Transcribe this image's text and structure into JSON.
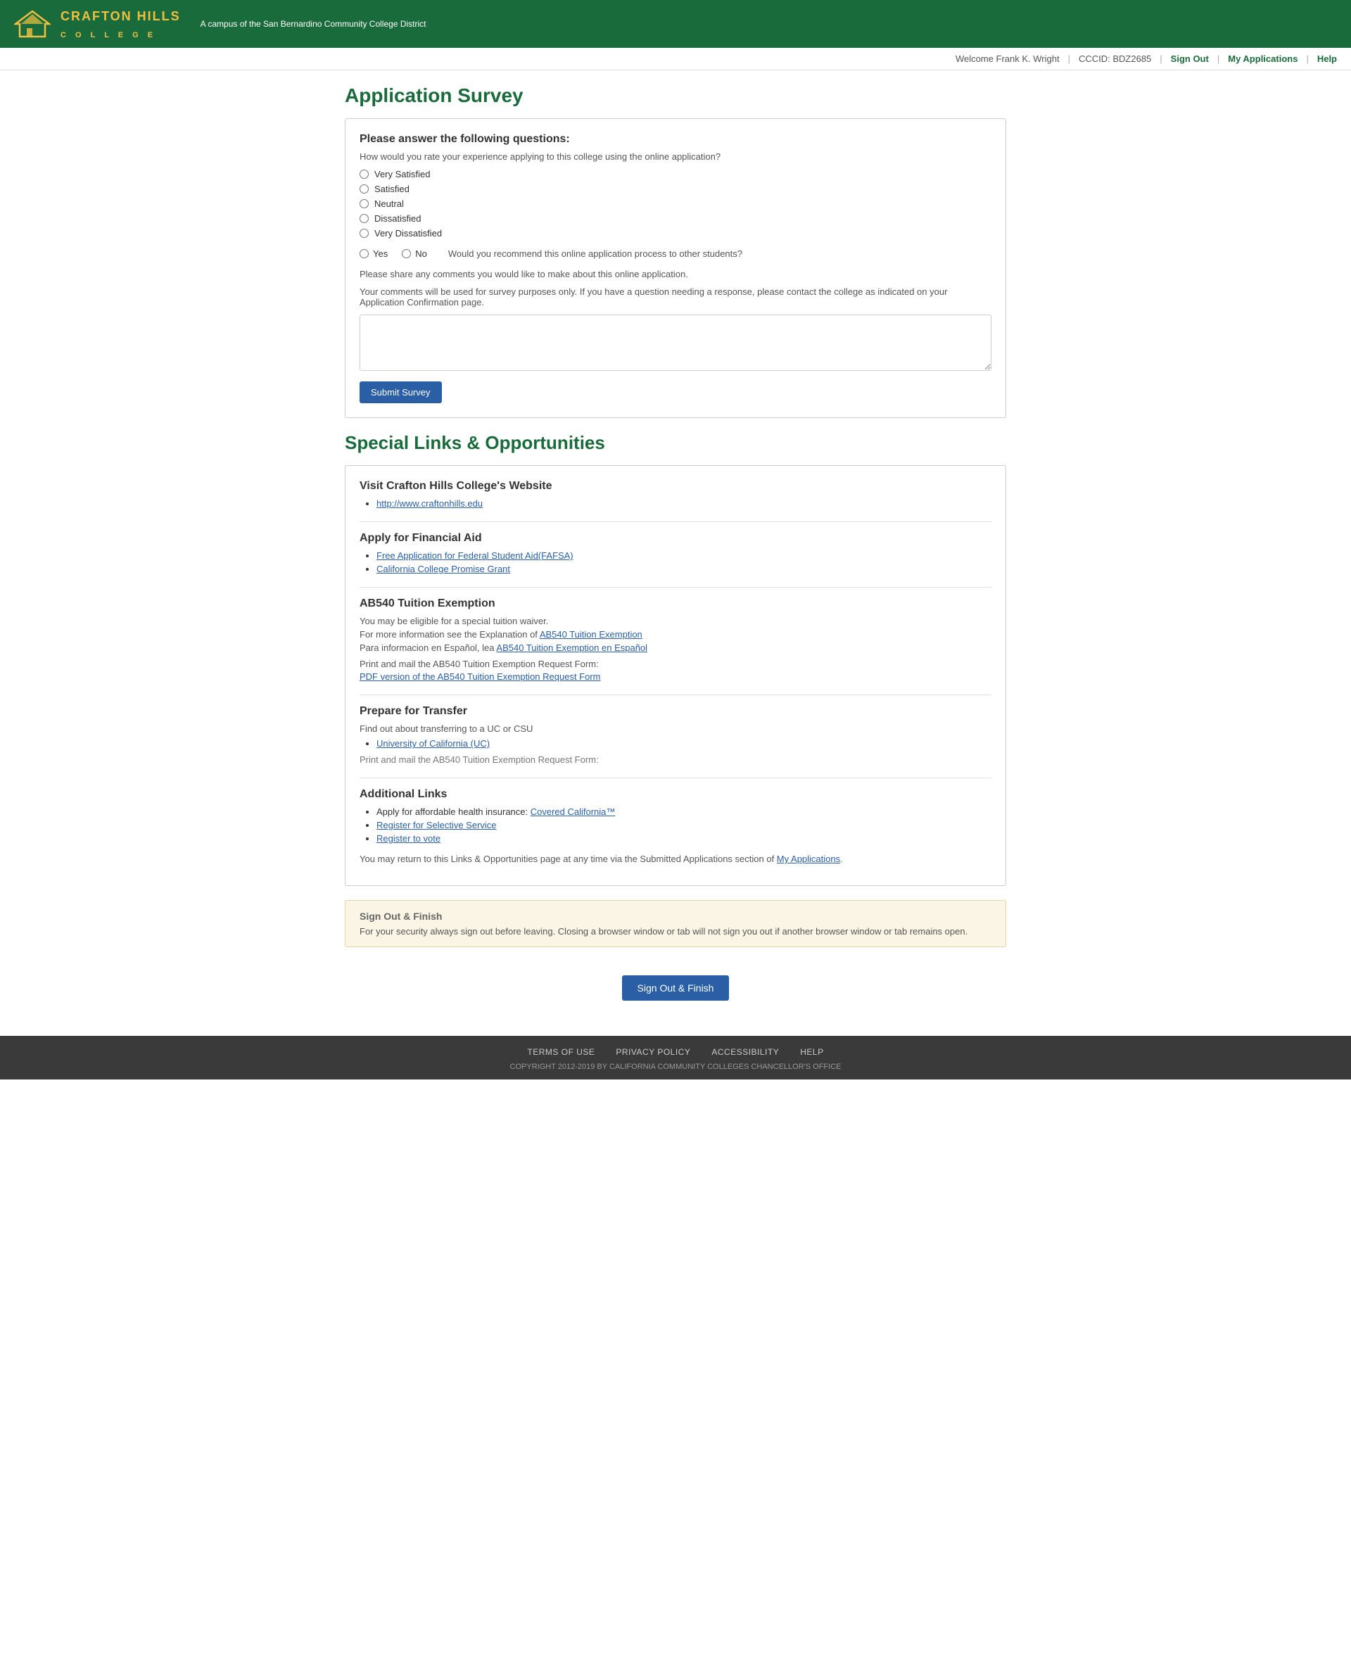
{
  "header": {
    "logo_main": "CRAFTON HILLS",
    "logo_sub_line1": "C O L L E G E",
    "tagline": "A campus of the San Bernardino Community College District",
    "nav": {
      "welcome_text": "Welcome Frank K. Wright",
      "cccid_text": "CCCID: BDZ2685",
      "signout_label": "Sign Out",
      "my_applications_label": "My Applications",
      "help_label": "Help"
    }
  },
  "survey": {
    "page_title": "Application Survey",
    "card_heading": "Please answer the following questions:",
    "rating_question": "How would you rate your experience applying to this college using the online application?",
    "rating_options": [
      "Very Satisfied",
      "Satisfied",
      "Neutral",
      "Dissatisfied",
      "Very Dissatisfied"
    ],
    "recommend_options": [
      "Yes",
      "No"
    ],
    "recommend_question": "Would you recommend this online application process to other students?",
    "comments_label": "Please share any comments you would like to make about this online application.",
    "comments_sub": "Your comments will be used for survey purposes only. If you have a question needing a response, please contact the college as indicated on your Application Confirmation page.",
    "submit_label": "Submit Survey"
  },
  "special_links": {
    "section_title": "Special Links & Opportunities",
    "college_website": {
      "heading": "Visit Crafton Hills College's Website",
      "url_text": "http://www.craftonhills.edu",
      "url_href": "http://www.craftonhills.edu"
    },
    "financial_aid": {
      "heading": "Apply for Financial Aid",
      "links": [
        {
          "text": "Free Application for Federal Student Aid(FAFSA)",
          "href": "#"
        },
        {
          "text": "California College Promise Grant",
          "href": "#"
        }
      ]
    },
    "ab540": {
      "heading": "AB540 Tuition Exemption",
      "line1": "You may be eligible for a special tuition waiver.",
      "line2_prefix": "For more information see the Explanation of ",
      "line2_link_text": "AB540 Tuition Exemption",
      "line2_href": "#",
      "line3_prefix": "Para informacion en Español, lea ",
      "line3_link_text": "AB540 Tuition Exemption en Español",
      "line3_href": "#",
      "form_label": "Print and mail the AB540 Tuition Exemption Request Form:",
      "form_link_text": "PDF version of the AB540 Tuition Exemption Request Form",
      "form_href": "#"
    },
    "transfer": {
      "heading": "Prepare for Transfer",
      "text": "Find out about transferring to a UC or CSU",
      "links": [
        {
          "text": "University of California (UC)",
          "href": "#"
        }
      ],
      "trailing_text": "Print and mail the AB540 Tuition Exemption Request Form:"
    },
    "additional": {
      "heading": "Additional Links",
      "items": [
        {
          "prefix": "Apply for affordable health insurance: ",
          "link_text": "Covered California™",
          "href": "#"
        },
        {
          "prefix": "",
          "link_text": "Register for Selective Service",
          "href": "#"
        },
        {
          "prefix": "",
          "link_text": "Register to vote",
          "href": "#"
        }
      ]
    },
    "return_note_prefix": "You may return to this Links & Opportunities page at any time via the Submitted Applications section of ",
    "return_note_link_text": "My Applications",
    "return_note_href": "#",
    "return_note_suffix": "."
  },
  "signout_section": {
    "heading": "Sign Out & Finish",
    "warning": "For your security always sign out before leaving. Closing a browser window or tab will not sign you out if another browser window or tab remains open.",
    "button_label": "Sign Out & Finish"
  },
  "footer": {
    "links": [
      "TERMS OF USE",
      "PRIVACY POLICY",
      "ACCESSIBILITY",
      "HELP"
    ],
    "copyright": "COPYRIGHT 2012-2019 BY CALIFORNIA COMMUNITY COLLEGES CHANCELLOR'S OFFICE"
  }
}
